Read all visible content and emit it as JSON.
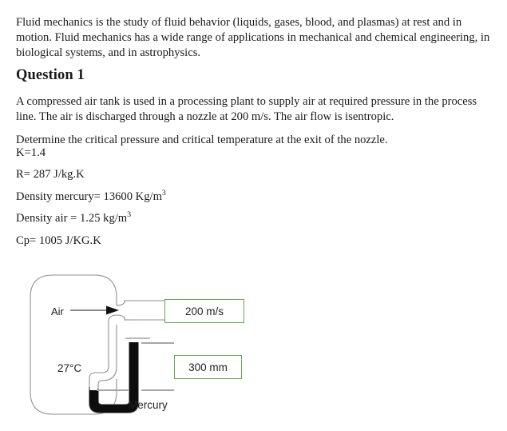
{
  "intro": {
    "paragraph": "Fluid mechanics is the study of fluid behavior (liquids, gases, blood, and plasmas) at rest and in motion. Fluid mechanics has a wide range of applications in mechanical and chemical engineering, in biological systems, and in astrophysics."
  },
  "question": {
    "title": "Question 1",
    "statement": "A compressed air tank is used in a processing plant to supply air at required pressure in the process line. The air is discharged through a nozzle at 200 m/s. The air flow is isentropic.",
    "task": "Determine the critical pressure and critical temperature at the exit of the nozzle."
  },
  "givens": [
    {
      "id": "k",
      "label": "K=1.4"
    },
    {
      "id": "gas-constant",
      "label": "R= 287 J/kg.K"
    },
    {
      "id": "density-mercury",
      "prefix": "Density mercury= 13600 Kg/m",
      "sup": "3"
    },
    {
      "id": "density-air",
      "prefix": "Density air = 1.25 kg/m",
      "sup": "3"
    },
    {
      "id": "cp",
      "label": "Cp= 1005 J/KG.K"
    }
  ],
  "diagram": {
    "tank_label": "Air",
    "tank_temperature": "27°C",
    "manometer_fluid": "Mercury",
    "callouts": [
      {
        "id": "exit-velocity",
        "text": "200 m/s"
      },
      {
        "id": "manometer-height",
        "text": "300 mm"
      }
    ],
    "colors": {
      "callout_border": "#6aa84f",
      "outline": "#8a8a8a",
      "mercury": "#0d0d0d",
      "dimension_line": "#9b9b9b",
      "background": "#ffffff"
    }
  }
}
